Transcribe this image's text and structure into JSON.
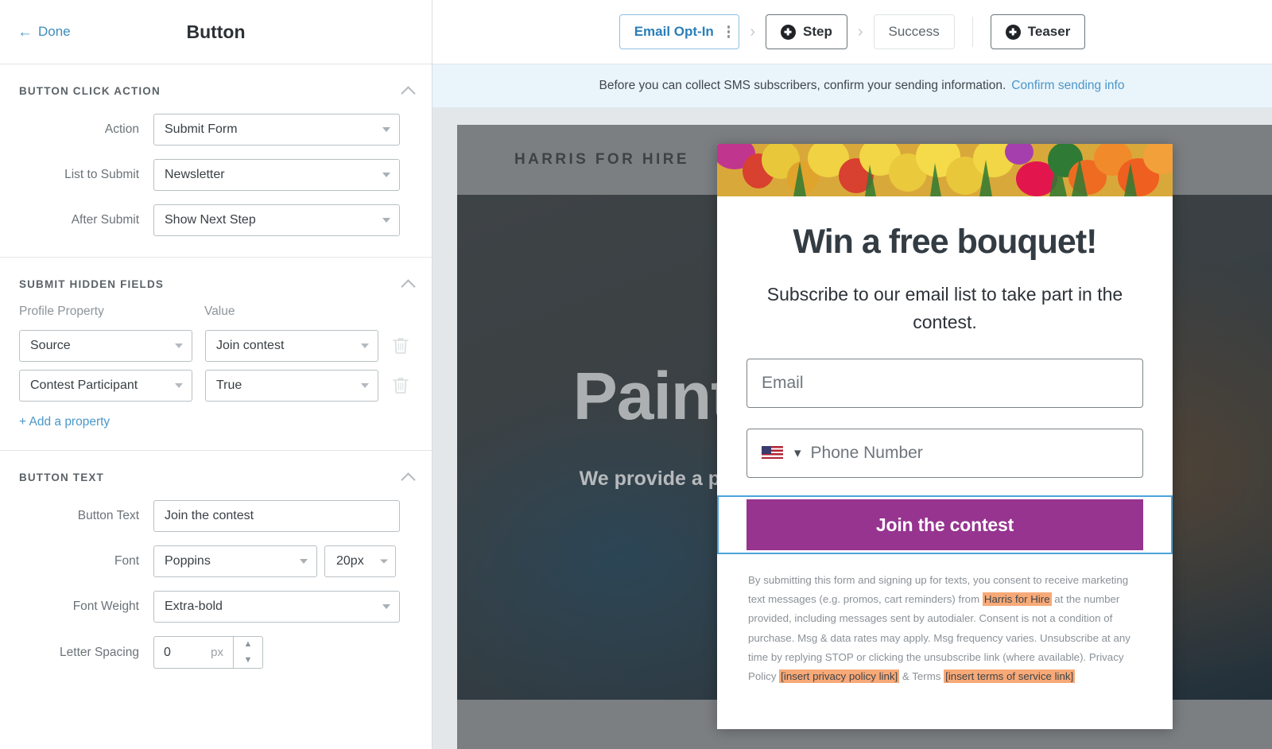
{
  "editor": {
    "back_label": "Done",
    "title": "Button",
    "sections": {
      "click_action": {
        "title": "BUTTON CLICK ACTION",
        "rows": [
          {
            "label": "Action",
            "value": "Submit Form"
          },
          {
            "label": "List to Submit",
            "value": "Newsletter"
          },
          {
            "label": "After Submit",
            "value": "Show Next Step"
          }
        ]
      },
      "hidden_fields": {
        "title": "SUBMIT HIDDEN FIELDS",
        "col_property": "Profile Property",
        "col_value": "Value",
        "rows": [
          {
            "property": "Source",
            "value": "Join contest"
          },
          {
            "property": "Contest Participant",
            "value": "True"
          }
        ],
        "add_label": "+ Add a property"
      },
      "button_text": {
        "title": "BUTTON TEXT",
        "text_label": "Button Text",
        "text_value": "Join the contest",
        "font_label": "Font",
        "font_value": "Poppins",
        "font_size": "20px",
        "weight_label": "Font Weight",
        "weight_value": "Extra-bold",
        "spacing_label": "Letter Spacing",
        "spacing_value": "0",
        "spacing_unit": "px"
      }
    }
  },
  "topbar": {
    "steps": [
      {
        "label": "Email Opt-In",
        "state": "active",
        "has_kebab": true
      },
      {
        "label": "Step",
        "state": "dark",
        "has_plus": true
      },
      {
        "label": "Success",
        "state": "plain"
      }
    ],
    "separator": "›",
    "teaser": {
      "label": "Teaser",
      "has_plus": true
    }
  },
  "notice": {
    "text": "Before you can collect SMS subscribers, confirm your sending information.",
    "link": "Confirm sending info"
  },
  "site": {
    "brand": "HARRIS FOR HIRE",
    "headline": "Paint your passion",
    "subline": "We provide a premium gaming experience right to your door"
  },
  "popup": {
    "headline": "Win a free bouquet!",
    "subheadline": "Subscribe to our email list to take part in the contest.",
    "email_placeholder": "Email",
    "phone_placeholder": "Phone Number",
    "country_flag": "us-flag-icon",
    "cta_label": "Join the contest",
    "fine_print": {
      "p1": "By submitting this form and signing up for texts, you consent to receive marketing text messages (e.g. promos, cart reminders) from ",
      "brand": "Harris for Hire",
      "p2": " at the number provided, including messages sent by autodialer. Consent is not a condition of purchase. Msg & data rates may apply. Msg frequency varies. Unsubscribe at any time by replying STOP or clicking the unsubscribe link (where available). Privacy Policy ",
      "privacy_link": "[insert privacy policy link]",
      "p3": " & Terms ",
      "terms_link": "[insert terms of service link]"
    }
  },
  "colors": {
    "accent_blue": "#4a97c9",
    "cta_purple": "#96348f",
    "selection_blue": "#4aa3db",
    "notice_bg": "#eaf4fb",
    "highlight_orange": "#f7a977"
  }
}
